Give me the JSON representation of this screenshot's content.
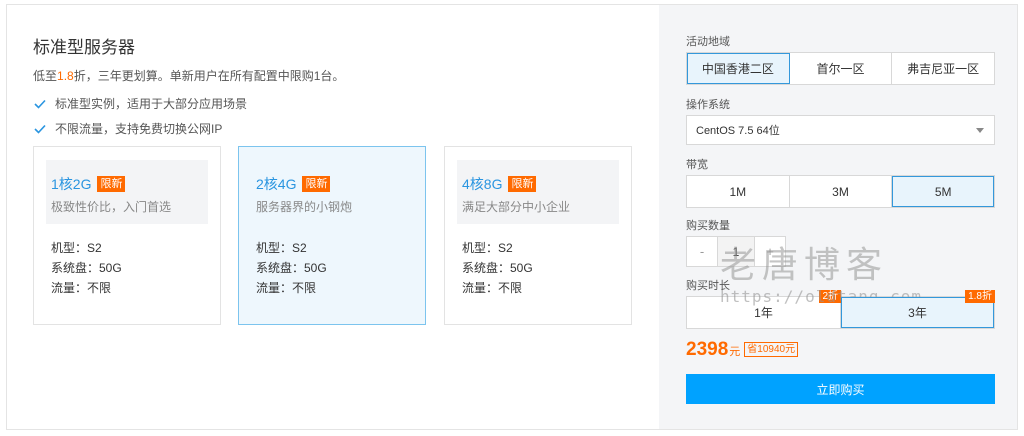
{
  "title": "标准型服务器",
  "subtitle": {
    "prefix": "低至",
    "highlight": "1.8",
    "suffix": "折，三年更划算。单新用户在所有配置中限购1台。"
  },
  "features": [
    "标准型实例，适用于大部分应用场景",
    "不限流量，支持免费切换公网IP"
  ],
  "cards": [
    {
      "spec": "1核2G",
      "badge": "限新",
      "desc": "极致性价比，入门首选",
      "model": "机型：S2",
      "disk": "系统盘：50G",
      "traffic": "流量：不限",
      "selected": false
    },
    {
      "spec": "2核4G",
      "badge": "限新",
      "desc": "服务器界的小钢炮",
      "model": "机型：S2",
      "disk": "系统盘：50G",
      "traffic": "流量：不限",
      "selected": true
    },
    {
      "spec": "4核8G",
      "badge": "限新",
      "desc": "满足大部分中小企业",
      "model": "机型：S2",
      "disk": "系统盘：50G",
      "traffic": "流量：不限",
      "selected": false
    }
  ],
  "region": {
    "label": "活动地域",
    "options": [
      "中国香港二区",
      "首尔一区",
      "弗吉尼亚一区"
    ],
    "selected": "中国香港二区"
  },
  "os": {
    "label": "操作系统",
    "value": "CentOS 7.5 64位"
  },
  "bandwidth": {
    "label": "带宽",
    "options": [
      "1M",
      "3M",
      "5M"
    ],
    "selected": "5M"
  },
  "quantity": {
    "label": "购买数量",
    "minus": "-",
    "value": "1",
    "plus": "+"
  },
  "duration": {
    "label": "购买时长",
    "options": [
      "1年",
      "3年"
    ],
    "selected": "3年",
    "tags": [
      "2折",
      "1.8折"
    ]
  },
  "price": {
    "value": "2398",
    "unit": "元",
    "save": "省10940元"
  },
  "buy_button": "立即购买",
  "watermark": {
    "text": "老唐博客",
    "url": "https://oldtang.com"
  },
  "colors": {
    "accent": "#ff6a00",
    "primary": "#00a2ff",
    "link": "#2a95e0"
  }
}
